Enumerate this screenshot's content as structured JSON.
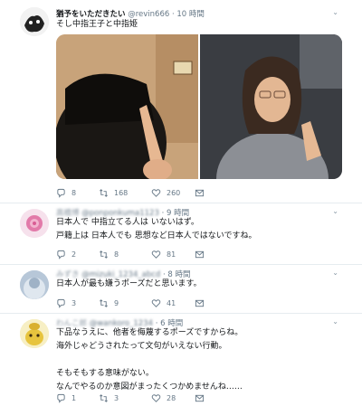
{
  "tweet": {
    "name": "猶予をいただきたい",
    "handle": "@revin666",
    "time": "10 時間",
    "text": "そし中指王子と中指姫",
    "replies": "8",
    "retweets": "168",
    "likes": "260"
  },
  "replies": [
    {
      "name": "高橋博",
      "handle": "@ponponkuma1123",
      "time": "9 時間",
      "lines": [
        "日本人で 中指立てる人は いないはず。",
        "戸籍上は 日本人でも 思想など日本人ではないですね。"
      ],
      "replies": "2",
      "retweets": "8",
      "likes": "81"
    },
    {
      "name": "みずき",
      "handle": "@mizuki_1234_abcd",
      "time": "8 時間",
      "lines": [
        "日本人が最も嫌うポーズだと思います。"
      ],
      "replies": "3",
      "retweets": "9",
      "likes": "41"
    },
    {
      "name": "わんこ郎",
      "handle": "@wankoro_1234",
      "time": "6 時間",
      "lines": [
        "下品なうえに、他者を侮蔑するポーズですからね。",
        "海外じゃどうされたって文句がいえない行動。",
        "",
        "そもそもする意味がない。",
        "なんでやるのか意図がまったくつかめませんね……"
      ],
      "replies": "1",
      "retweets": "3",
      "likes": "28"
    }
  ],
  "icons": {
    "reply": "reply-icon",
    "retweet": "retweet-icon",
    "like": "heart-icon",
    "message": "message-icon",
    "more": "chevron-down-icon"
  },
  "colors": {
    "text": "#14171a",
    "muted": "#657786",
    "divider": "#e6ecf0",
    "thread": "#cfd9de"
  }
}
